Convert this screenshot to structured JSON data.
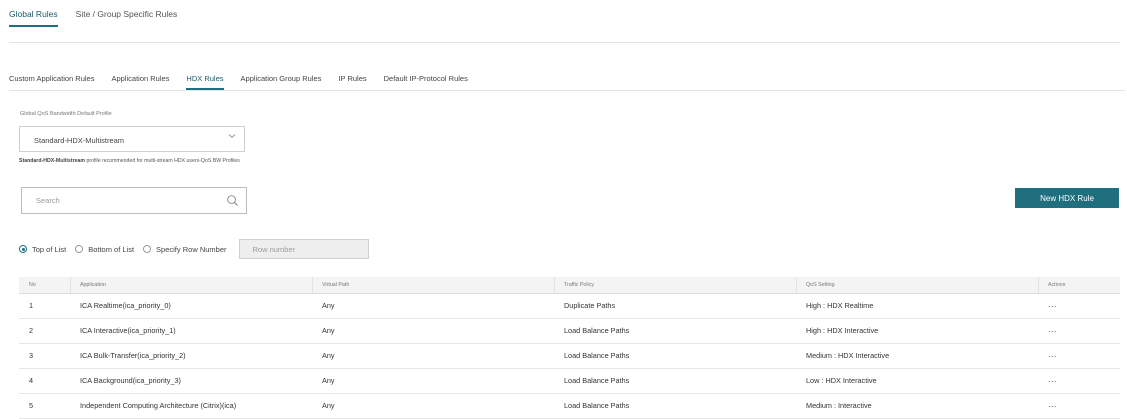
{
  "top_tabs": [
    {
      "label": "Global Rules",
      "active": true
    },
    {
      "label": "Site / Group Specific Rules",
      "active": false
    }
  ],
  "sub_tabs": [
    {
      "label": "Custom Application Rules"
    },
    {
      "label": "Application Rules"
    },
    {
      "label": "HDX Rules",
      "active": true
    },
    {
      "label": "Application Group Rules"
    },
    {
      "label": "IP Rules"
    },
    {
      "label": "Default IP-Protocol Rules"
    }
  ],
  "profile": {
    "label": "Global QoS Bandwidth Default Profile",
    "selected": "Standard-HDX-Multistream",
    "note_bold": "Standard-HDX-Multistream",
    "note_text": "profile recommended for multi-stream HDX users-QoS BW Profiles"
  },
  "search": {
    "placeholder": "Search"
  },
  "new_button_label": "New HDX Rule",
  "position": {
    "options": [
      "Top of List",
      "Bottom of List",
      "Specify Row Number"
    ],
    "selected": "Top of List",
    "row_number_placeholder": "Row number"
  },
  "table": {
    "headers": [
      "No",
      "Application",
      "Virtual Path",
      "Traffic Policy",
      "QoS Setting",
      "Actions"
    ],
    "rows": [
      {
        "no": "1",
        "application": "ICA Realtime(ica_priority_0)",
        "virtual_path": "Any",
        "traffic_policy": "Duplicate Paths",
        "qos": "High : HDX Realtime",
        "actions": "..."
      },
      {
        "no": "2",
        "application": "ICA Interactive(ica_priority_1)",
        "virtual_path": "Any",
        "traffic_policy": "Load Balance Paths",
        "qos": "High : HDX Interactive",
        "actions": "..."
      },
      {
        "no": "3",
        "application": "ICA Bulk-Transfer(ica_priority_2)",
        "virtual_path": "Any",
        "traffic_policy": "Load Balance Paths",
        "qos": "Medium : HDX Interactive",
        "actions": "..."
      },
      {
        "no": "4",
        "application": "ICA Background(ica_priority_3)",
        "virtual_path": "Any",
        "traffic_policy": "Load Balance Paths",
        "qos": "Low : HDX Interactive",
        "actions": "..."
      },
      {
        "no": "5",
        "application": "Independent Computing Architecture (Citrix)(ica)",
        "virtual_path": "Any",
        "traffic_policy": "Load Balance Paths",
        "qos": "Medium : Interactive",
        "actions": "..."
      }
    ]
  },
  "colors": {
    "accent": "#1f6f7f",
    "header_bg": "#f4f4f4",
    "border": "#e3e3e3"
  },
  "icons": {
    "dropdown": "chevron-down-icon",
    "search": "magnifier-icon"
  }
}
